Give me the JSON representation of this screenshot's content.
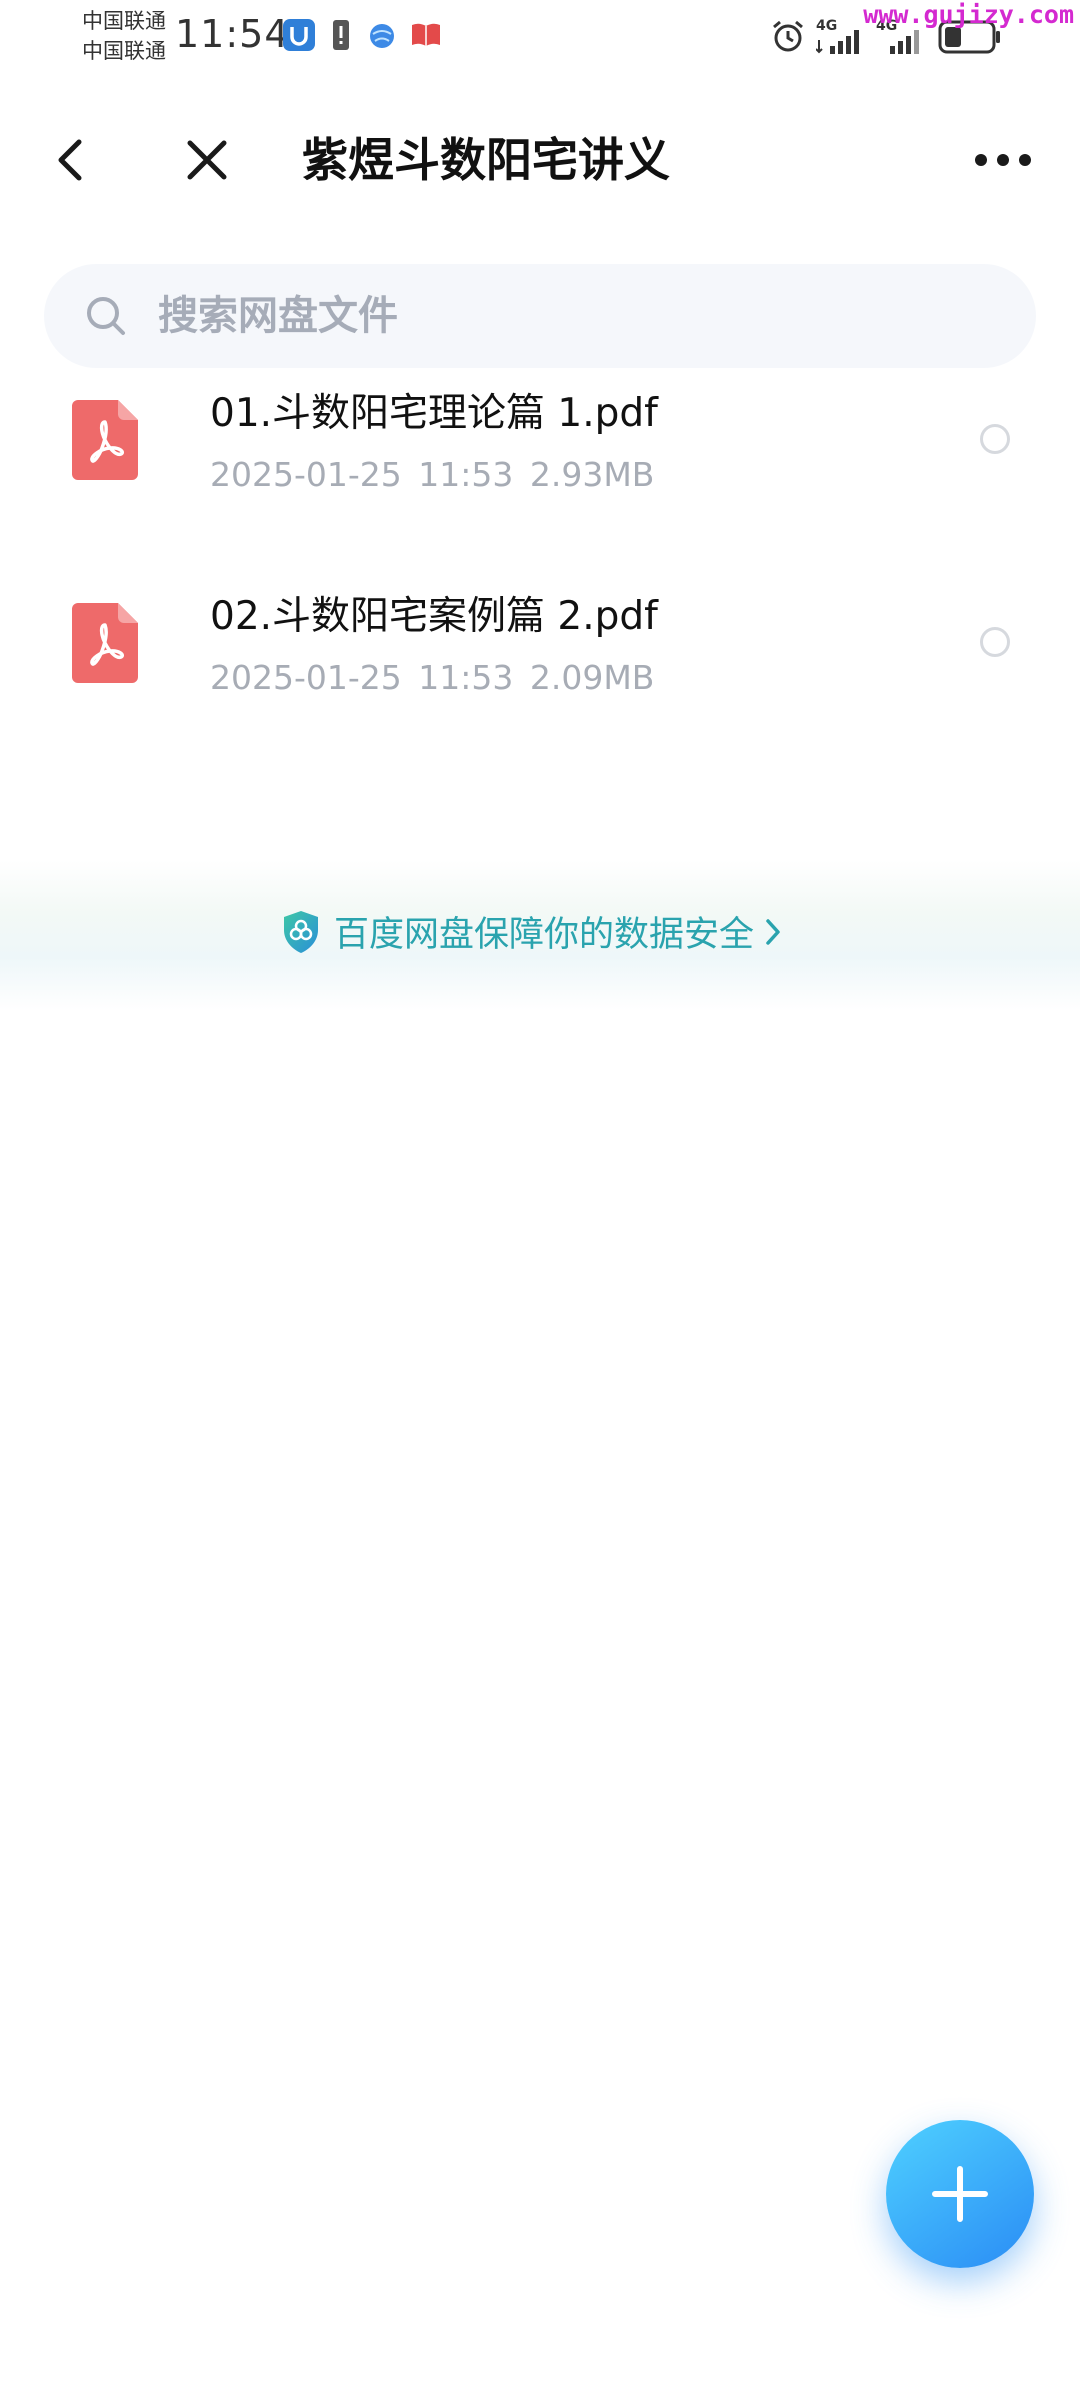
{
  "status_bar": {
    "carrier_1": "中国联通",
    "carrier_2": "中国联通",
    "time": "11:54",
    "network_1": "4G",
    "network_2": "4G",
    "watermark": "www.gujizy.com",
    "icons": [
      "app-u-icon",
      "sim-alert-icon",
      "browser-icon",
      "book-icon",
      "alarm-icon",
      "signal-icon",
      "signal-icon",
      "battery-icon"
    ]
  },
  "header": {
    "title": "紫煜斗数阳宅讲义",
    "icons": [
      "back-icon",
      "close-icon",
      "more-icon"
    ]
  },
  "search": {
    "placeholder": "搜索网盘文件"
  },
  "files": [
    {
      "name": "01.斗数阳宅理论篇 1.pdf",
      "meta": "2025-01-25  11:53  2.93MB",
      "type_icon": "pdf-file-icon"
    },
    {
      "name": "02.斗数阳宅案例篇 2.pdf",
      "meta": "2025-01-25  11:53  2.09MB",
      "type_icon": "pdf-file-icon"
    }
  ],
  "banner": {
    "text": "百度网盘保障你的数据安全",
    "icon": "shield-icon"
  },
  "fab": {
    "icon": "plus-icon"
  },
  "colors": {
    "accent": "#2a8cf5",
    "banner_text": "#2aa3ae",
    "pdf_red": "#ee6a6a",
    "meta_gray": "#a7acb5"
  }
}
